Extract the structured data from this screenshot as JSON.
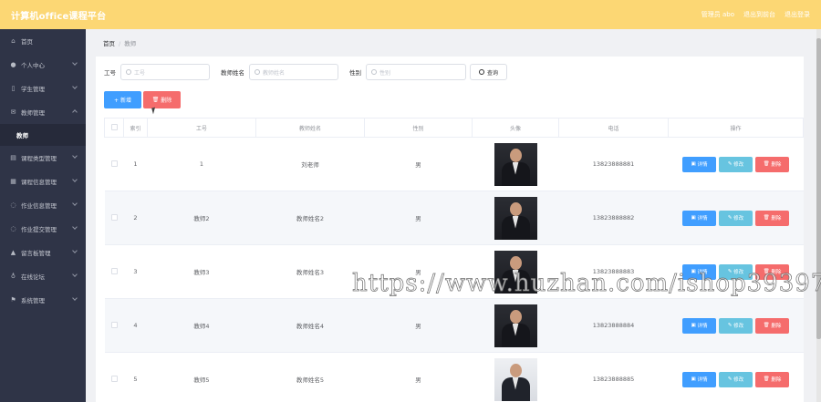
{
  "header": {
    "app_title": "计算机office课程平台",
    "admin": "管理员 abo",
    "exit_frontend": "退出到前台",
    "logout": "退出登录"
  },
  "sidebar": {
    "items": [
      {
        "label": "首页",
        "icon": "home-icon",
        "arrow": false
      },
      {
        "label": "个人中心",
        "icon": "user-icon",
        "arrow": true
      },
      {
        "label": "学生管理",
        "icon": "student-icon",
        "arrow": true
      },
      {
        "label": "教师管理",
        "icon": "mail-icon",
        "arrow": true,
        "open": true,
        "sub": "教师"
      },
      {
        "label": "课程类型管理",
        "icon": "chart-icon",
        "arrow": true
      },
      {
        "label": "课程信息管理",
        "icon": "grid-icon",
        "arrow": true
      },
      {
        "label": "作业信息管理",
        "icon": "info-icon",
        "arrow": true
      },
      {
        "label": "作业提交管理",
        "icon": "upload-icon",
        "arrow": true
      },
      {
        "label": "留言板管理",
        "icon": "message-icon",
        "arrow": true
      },
      {
        "label": "在线论坛",
        "icon": "mic-icon",
        "arrow": true
      },
      {
        "label": "系统管理",
        "icon": "flag-icon",
        "arrow": true
      }
    ]
  },
  "breadcrumb": {
    "home": "首页",
    "current": "教师"
  },
  "search": {
    "field1_label": "工号",
    "field1_placeholder": "工号",
    "field2_label": "教师姓名",
    "field2_placeholder": "教师姓名",
    "field3_label": "性别",
    "field3_placeholder": "性别",
    "query_button": "查询"
  },
  "actions": {
    "add": "+ 新增",
    "delete": "删除"
  },
  "table": {
    "headers": [
      "索引",
      "工号",
      "教师姓名",
      "性别",
      "头像",
      "电话",
      "操作"
    ],
    "op_detail": "详情",
    "op_edit": "修改",
    "op_delete": "删除",
    "rows": [
      {
        "index": "1",
        "id": "1",
        "name": "刘老师",
        "gender": "男",
        "phone": "13823888881"
      },
      {
        "index": "2",
        "id": "教师2",
        "name": "教师姓名2",
        "gender": "男",
        "phone": "13823888882"
      },
      {
        "index": "3",
        "id": "教师3",
        "name": "教师姓名3",
        "gender": "男",
        "phone": "13823888883"
      },
      {
        "index": "4",
        "id": "教师4",
        "name": "教师姓名4",
        "gender": "男",
        "phone": "13823888884"
      },
      {
        "index": "5",
        "id": "教师5",
        "name": "教师姓名5",
        "gender": "男",
        "phone": "13823888885"
      }
    ]
  },
  "watermark": "https://www.huzhan.com/ishop39397",
  "colors": {
    "header": "#fcd774",
    "sidebar": "#2f3447",
    "primary": "#409eff",
    "danger": "#f56c6c",
    "info": "#67c4e0"
  }
}
